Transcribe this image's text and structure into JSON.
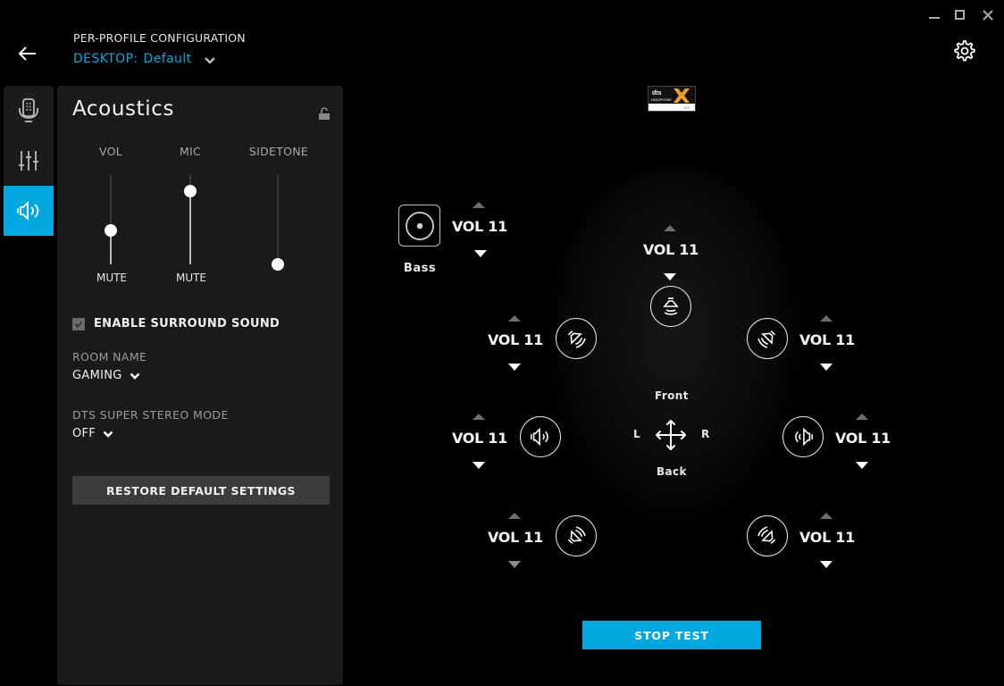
{
  "window": {
    "controls": [
      "minimize",
      "maximize",
      "close"
    ]
  },
  "header": {
    "title": "PER-PROFILE CONFIGURATION",
    "profile_key": "DESKTOP:",
    "profile_value": "Default",
    "back_icon": "arrow-left-icon",
    "settings_icon": "gear-icon"
  },
  "sidebar": {
    "tabs": [
      {
        "name": "microphone",
        "icon": "microphone-icon",
        "active": false
      },
      {
        "name": "equalizer",
        "icon": "equalizer-icon",
        "active": false
      },
      {
        "name": "acoustics",
        "icon": "speaker-surround-icon",
        "active": true
      }
    ]
  },
  "panel": {
    "title": "Acoustics",
    "lock_icon": "unlock-icon",
    "sliders": [
      {
        "label": "VOL",
        "bottom_label": "MUTE",
        "level": 0.38
      },
      {
        "label": "MIC",
        "bottom_label": "MUTE",
        "level": 0.82
      },
      {
        "label": "SIDETONE",
        "bottom_label": "",
        "level": 0.0
      }
    ],
    "surround": {
      "label": "ENABLE SURROUND SOUND",
      "checked": true
    },
    "room": {
      "label": "ROOM NAME",
      "value": "GAMING"
    },
    "dts_mode": {
      "label": "DTS SUPER STEREO MODE",
      "value": "OFF"
    },
    "restore_label": "RESTORE DEFAULT SETTINGS"
  },
  "surround_view": {
    "logo": {
      "brand": "dts",
      "product": "HEADPHONE X",
      "version": "2.0"
    },
    "bass": {
      "label": "Bass",
      "volume": "VOL 11"
    },
    "channels": [
      {
        "id": "center",
        "volume": "VOL 11"
      },
      {
        "id": "front-left",
        "volume": "VOL 11"
      },
      {
        "id": "front-right",
        "volume": "VOL 11"
      },
      {
        "id": "side-left",
        "volume": "VOL 11"
      },
      {
        "id": "side-right",
        "volume": "VOL 11"
      },
      {
        "id": "rear-left",
        "volume": "VOL 11"
      },
      {
        "id": "rear-right",
        "volume": "VOL 11"
      }
    ],
    "orientation": {
      "front": "Front",
      "back": "Back",
      "left": "L",
      "right": "R"
    },
    "stop_test_label": "STOP TEST"
  },
  "colors": {
    "accent": "#00a8e0",
    "panel_bg": "#1a1a1a",
    "button_bg": "#3c3c3c"
  }
}
